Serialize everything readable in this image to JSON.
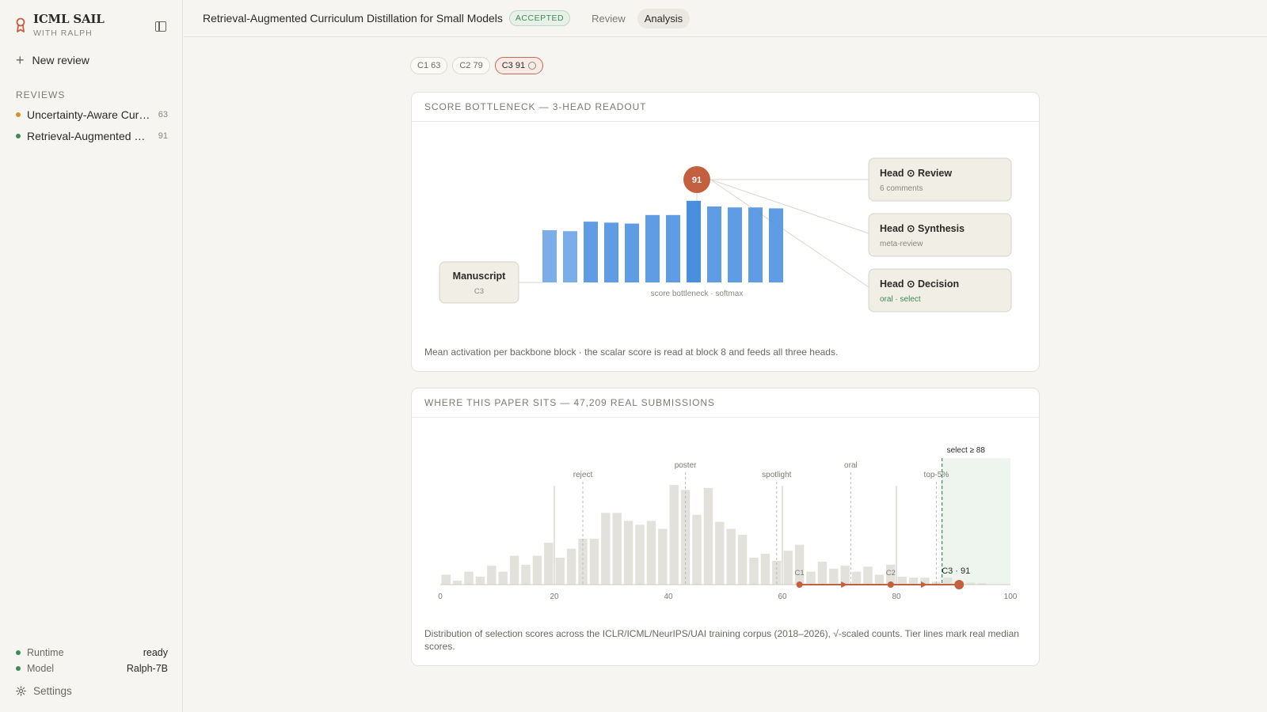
{
  "sidebar": {
    "brand_name": "ICML SAIL",
    "brand_sub": "WITH RALPH",
    "new_review_label": "New review",
    "reviews_label": "REVIEWS",
    "reviews": [
      {
        "title": "Uncertainty-Aware Curriculum Distillation",
        "score": "63",
        "dot_color": "#d4922f"
      },
      {
        "title": "Retrieval-Augmented Curriculum Distillation for Small Models",
        "score": "91",
        "dot_color": "#3f8a55"
      }
    ],
    "status": [
      {
        "label": "Runtime",
        "value": "ready"
      },
      {
        "label": "Model",
        "value": "Ralph-7B"
      }
    ],
    "settings_label": "Settings"
  },
  "topbar": {
    "paper_title": "Retrieval-Augmented Curriculum Distillation for Small Models",
    "status_badge": "ACCEPTED",
    "tabs": [
      {
        "label": "Review",
        "active": false
      },
      {
        "label": "Analysis",
        "active": true
      }
    ]
  },
  "chips": [
    {
      "label": "C1 63",
      "active": false
    },
    {
      "label": "C2 79",
      "active": false
    },
    {
      "label": "C3 91",
      "active": true
    }
  ],
  "bottleneck": {
    "header": "SCORE BOTTLENECK — 3-HEAD READOUT",
    "manuscript_label": "Manuscript",
    "manuscript_sub": "C3",
    "score_node": "91",
    "bars_caption": "score bottleneck · softmax",
    "heads": [
      {
        "title": "Head ⊙ Review",
        "sub": "6 comments"
      },
      {
        "title": "Head ⊙ Synthesis",
        "sub": "meta-review"
      },
      {
        "title": "Head ⊙ Decision",
        "sub": "oral · select"
      }
    ],
    "caption": "Mean activation per backbone block · the scalar score is read at block 8 and feeds all three heads.",
    "activations": [
      0.55,
      0.54,
      0.64,
      0.63,
      0.62,
      0.71,
      0.71,
      0.86,
      0.8,
      0.79,
      0.79,
      0.78
    ]
  },
  "distribution": {
    "header": "WHERE THIS PAPER SITS — 47,209 REAL SUBMISSIONS",
    "caption": "Distribution of selection scores across the ICLR/ICML/NeurIPS/UAI training corpus (2018–2026), √-scaled counts. Tier lines mark real median scores.",
    "chart_data": {
      "type": "bar",
      "x_range": [
        0,
        100
      ],
      "x_ticks": [
        "0",
        "20",
        "40",
        "60",
        "80",
        "100"
      ],
      "y_scale": "sqrt",
      "bin_width": 2,
      "relative_heights": [
        0.1,
        0.04,
        0.13,
        0.08,
        0.19,
        0.13,
        0.29,
        0.2,
        0.29,
        0.42,
        0.27,
        0.36,
        0.46,
        0.46,
        0.72,
        0.72,
        0.64,
        0.6,
        0.64,
        0.56,
        1.0,
        0.95,
        0.7,
        0.97,
        0.63,
        0.56,
        0.5,
        0.27,
        0.31,
        0.24,
        0.34,
        0.4,
        0.13,
        0.23,
        0.16,
        0.19,
        0.13,
        0.18,
        0.1,
        0.2,
        0.08,
        0.07,
        0.07,
        0.03,
        0.07,
        0.03,
        0.02,
        0.015
      ],
      "tiers": [
        {
          "label": "reject",
          "value": 25
        },
        {
          "label": "poster",
          "value": 43
        },
        {
          "label": "spotlight",
          "value": 59
        },
        {
          "label": "oral",
          "value": 72
        },
        {
          "label": "top-5%",
          "value": 87
        }
      ],
      "threshold": {
        "label": "select ≥ 88",
        "value": 88
      },
      "checkpoints": [
        {
          "label": "C1",
          "value": 63
        },
        {
          "label": "C2",
          "value": 79
        },
        {
          "label": "C3 · 91",
          "value": 91
        }
      ],
      "reference_lines": [
        20,
        60,
        80
      ]
    }
  },
  "colors": {
    "accent": "#c2603f",
    "bar_blue": "#4a8ee0",
    "success": "#3f8a55",
    "hist_bar": "#e3e1db"
  }
}
